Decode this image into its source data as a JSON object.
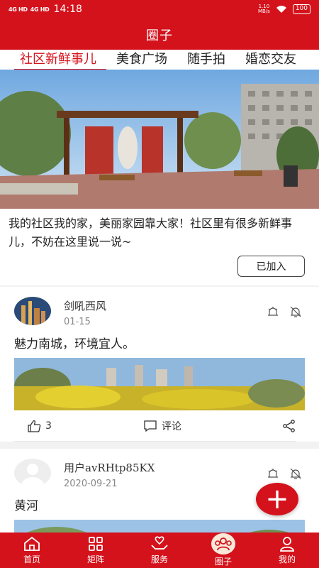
{
  "status_bar": {
    "signal1": "4G HD",
    "signal2": "4G HD",
    "time": "14:18",
    "speed_value": "1.10",
    "speed_unit": "MB/s",
    "battery": "100"
  },
  "header": {
    "title": "圈子"
  },
  "tabs": [
    {
      "label": "社区新鲜事儿",
      "active": true
    },
    {
      "label": "美食广场",
      "active": false
    },
    {
      "label": "随手拍",
      "active": false
    },
    {
      "label": "婚恋交友",
      "active": false
    }
  ],
  "intro": {
    "text": "我的社区我的家，美丽家园靠大家！社区里有很多新鲜事儿，不妨在这里说一说~",
    "joined_label": "已加入"
  },
  "posts": [
    {
      "username": "剑吼西风",
      "date": "01-15",
      "text": "魅力南城，环境宜人。",
      "likes": "3",
      "comment_label": "评论"
    },
    {
      "username": "用户avRHtp85KX",
      "date": "2020-09-21",
      "text": "黄河"
    }
  ],
  "fab": {
    "symbol": "+"
  },
  "bottom_nav": [
    {
      "label": "首页",
      "icon": "home-icon"
    },
    {
      "label": "矩阵",
      "icon": "grid-icon"
    },
    {
      "label": "服务",
      "icon": "service-icon"
    },
    {
      "label": "圈子",
      "icon": "circle-icon",
      "active": true
    },
    {
      "label": "我的",
      "icon": "user-icon"
    }
  ],
  "colors": {
    "brand": "#d4121c"
  }
}
